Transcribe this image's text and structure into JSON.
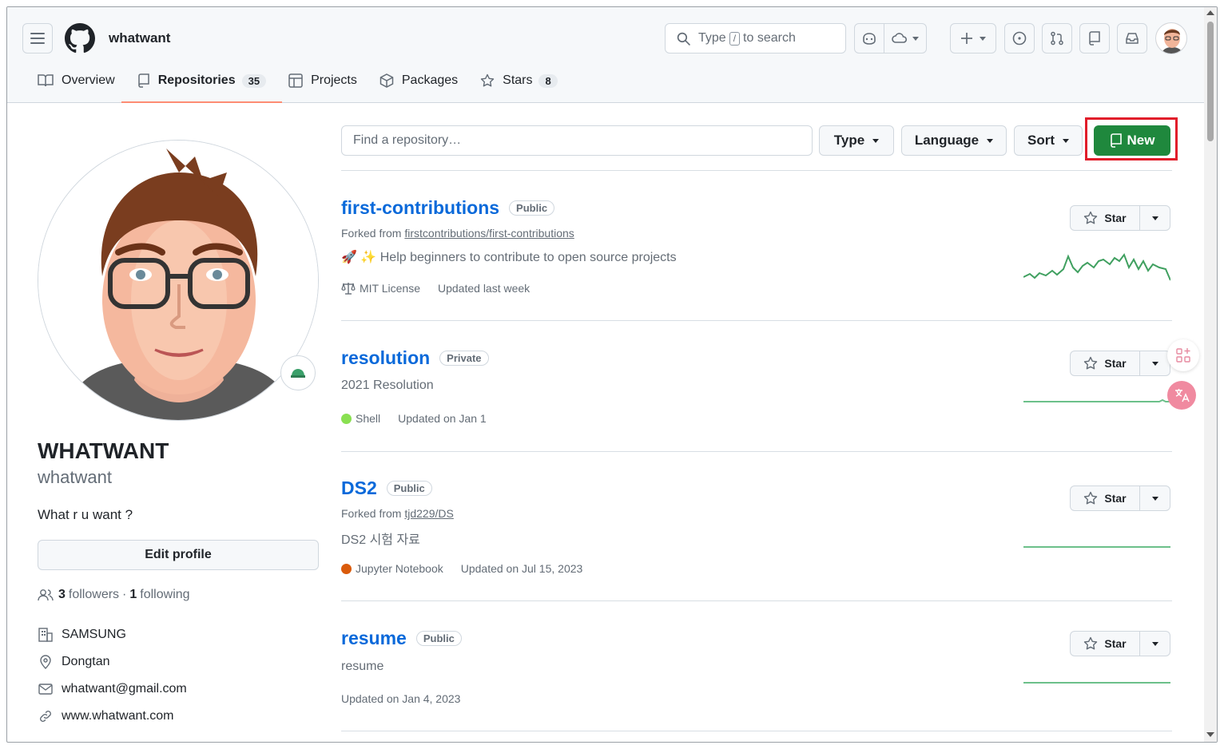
{
  "header": {
    "username": "whatwant",
    "search_prefix": "Type",
    "search_key": "/",
    "search_suffix": "to search"
  },
  "tabs": [
    {
      "label": "Overview",
      "icon": "book-icon"
    },
    {
      "label": "Repositories",
      "icon": "repo-icon",
      "count": "35",
      "active": true
    },
    {
      "label": "Projects",
      "icon": "table-icon"
    },
    {
      "label": "Packages",
      "icon": "package-icon"
    },
    {
      "label": "Stars",
      "icon": "star-icon",
      "count": "8"
    }
  ],
  "profile": {
    "name": "WHATWANT",
    "login": "whatwant",
    "bio": "What r u want ?",
    "edit_label": "Edit profile",
    "followers_count": "3",
    "followers_label": "followers",
    "separator": "·",
    "following_count": "1",
    "following_label": "following",
    "company": "SAMSUNG",
    "location": "Dongtan",
    "email": "whatwant@gmail.com",
    "website": "www.whatwant.com"
  },
  "filters": {
    "find_placeholder": "Find a repository…",
    "type_label": "Type",
    "language_label": "Language",
    "sort_label": "Sort",
    "new_label": "New"
  },
  "repos": [
    {
      "name": "first-contributions",
      "visibility": "Public",
      "forked_prefix": "Forked from",
      "forked_from": "firstcontributions/first-contributions",
      "description": "🚀 ✨ Help beginners to contribute to open source projects",
      "license": "MIT License",
      "updated": "Updated last week"
    },
    {
      "name": "resolution",
      "visibility": "Private",
      "description": "2021 Resolution",
      "language": "Shell",
      "language_color": "#89e051",
      "updated": "Updated on Jan 1"
    },
    {
      "name": "DS2",
      "visibility": "Public",
      "forked_prefix": "Forked from",
      "forked_from": "tjd229/DS",
      "description": "DS2 시험 자료",
      "language": "Jupyter Notebook",
      "language_color": "#da5b0b",
      "updated": "Updated on Jul 15, 2023"
    },
    {
      "name": "resume",
      "visibility": "Public",
      "description": "resume",
      "updated": "Updated on Jan 4, 2023"
    }
  ],
  "star_label": "Star",
  "colors": {
    "accent_green": "#1f883d",
    "link_blue": "#0969da",
    "tab_underline": "#fd8c73",
    "highlight_red": "#e11d2a"
  }
}
